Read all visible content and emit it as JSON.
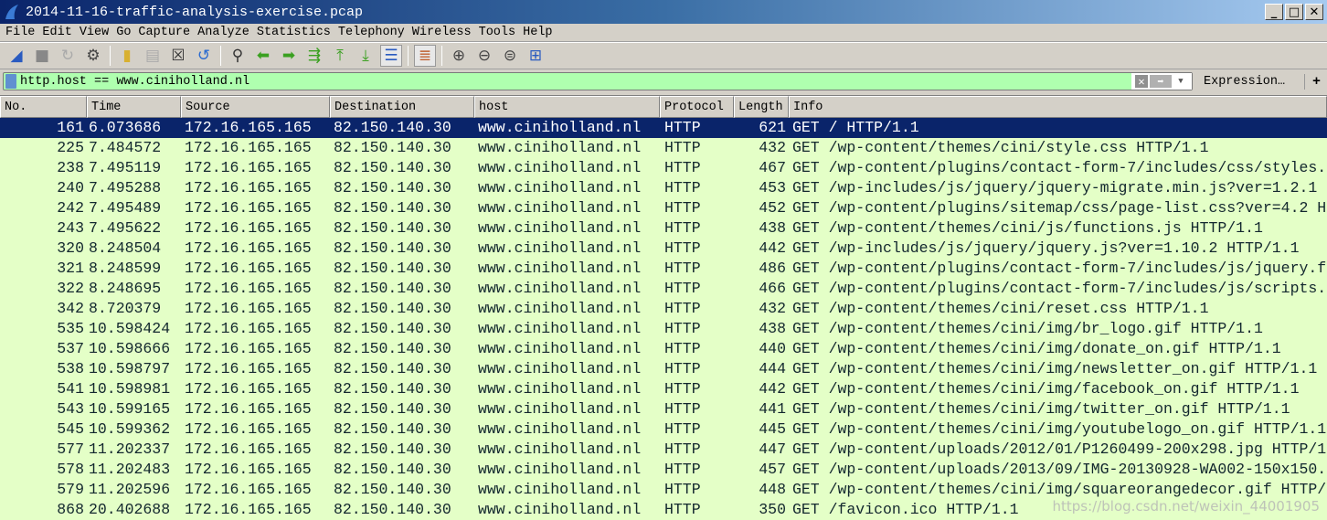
{
  "window": {
    "title": "2014-11-16-traffic-analysis-exercise.pcap",
    "controls": [
      "_",
      "□",
      "✕"
    ]
  },
  "menu": [
    "File",
    "Edit",
    "View",
    "Go",
    "Capture",
    "Analyze",
    "Statistics",
    "Telephony",
    "Wireless",
    "Tools",
    "Help"
  ],
  "toolbar": [
    "start-capture",
    "stop-capture",
    "restart-capture",
    "capture-options",
    "open-file",
    "save-file",
    "close-file",
    "reload-file",
    "find-packet",
    "go-back",
    "go-forward",
    "go-to-packet",
    "go-first",
    "go-last",
    "auto-scroll",
    "colorize",
    "zoom-in",
    "zoom-out",
    "zoom-normal",
    "resize-columns"
  ],
  "filter": {
    "value": "http.host == www.ciniholland.nl",
    "expression_label": "Expression…",
    "add_label": "+"
  },
  "columns": [
    "No.",
    "Time",
    "Source",
    "Destination",
    "host",
    "Protocol",
    "Length",
    "Info"
  ],
  "rows": [
    [
      "161",
      "6.073686",
      "172.16.165.165",
      "82.150.140.30",
      "www.ciniholland.nl",
      "HTTP",
      "621",
      "GET / HTTP/1.1"
    ],
    [
      "225",
      "7.484572",
      "172.16.165.165",
      "82.150.140.30",
      "www.ciniholland.nl",
      "HTTP",
      "432",
      "GET /wp-content/themes/cini/style.css HTTP/1.1"
    ],
    [
      "238",
      "7.495119",
      "172.16.165.165",
      "82.150.140.30",
      "www.ciniholland.nl",
      "HTTP",
      "467",
      "GET /wp-content/plugins/contact-form-7/includes/css/styles."
    ],
    [
      "240",
      "7.495288",
      "172.16.165.165",
      "82.150.140.30",
      "www.ciniholland.nl",
      "HTTP",
      "453",
      "GET /wp-includes/js/jquery/jquery-migrate.min.js?ver=1.2.1"
    ],
    [
      "242",
      "7.495489",
      "172.16.165.165",
      "82.150.140.30",
      "www.ciniholland.nl",
      "HTTP",
      "452",
      "GET /wp-content/plugins/sitemap/css/page-list.css?ver=4.2 H"
    ],
    [
      "243",
      "7.495622",
      "172.16.165.165",
      "82.150.140.30",
      "www.ciniholland.nl",
      "HTTP",
      "438",
      "GET /wp-content/themes/cini/js/functions.js HTTP/1.1"
    ],
    [
      "320",
      "8.248504",
      "172.16.165.165",
      "82.150.140.30",
      "www.ciniholland.nl",
      "HTTP",
      "442",
      "GET /wp-includes/js/jquery/jquery.js?ver=1.10.2 HTTP/1.1"
    ],
    [
      "321",
      "8.248599",
      "172.16.165.165",
      "82.150.140.30",
      "www.ciniholland.nl",
      "HTTP",
      "486",
      "GET /wp-content/plugins/contact-form-7/includes/js/jquery.f"
    ],
    [
      "322",
      "8.248695",
      "172.16.165.165",
      "82.150.140.30",
      "www.ciniholland.nl",
      "HTTP",
      "466",
      "GET /wp-content/plugins/contact-form-7/includes/js/scripts."
    ],
    [
      "342",
      "8.720379",
      "172.16.165.165",
      "82.150.140.30",
      "www.ciniholland.nl",
      "HTTP",
      "432",
      "GET /wp-content/themes/cini/reset.css HTTP/1.1"
    ],
    [
      "535",
      "10.598424",
      "172.16.165.165",
      "82.150.140.30",
      "www.ciniholland.nl",
      "HTTP",
      "438",
      "GET /wp-content/themes/cini/img/br_logo.gif HTTP/1.1"
    ],
    [
      "537",
      "10.598666",
      "172.16.165.165",
      "82.150.140.30",
      "www.ciniholland.nl",
      "HTTP",
      "440",
      "GET /wp-content/themes/cini/img/donate_on.gif HTTP/1.1"
    ],
    [
      "538",
      "10.598797",
      "172.16.165.165",
      "82.150.140.30",
      "www.ciniholland.nl",
      "HTTP",
      "444",
      "GET /wp-content/themes/cini/img/newsletter_on.gif HTTP/1.1"
    ],
    [
      "541",
      "10.598981",
      "172.16.165.165",
      "82.150.140.30",
      "www.ciniholland.nl",
      "HTTP",
      "442",
      "GET /wp-content/themes/cini/img/facebook_on.gif HTTP/1.1"
    ],
    [
      "543",
      "10.599165",
      "172.16.165.165",
      "82.150.140.30",
      "www.ciniholland.nl",
      "HTTP",
      "441",
      "GET /wp-content/themes/cini/img/twitter_on.gif HTTP/1.1"
    ],
    [
      "545",
      "10.599362",
      "172.16.165.165",
      "82.150.140.30",
      "www.ciniholland.nl",
      "HTTP",
      "445",
      "GET /wp-content/themes/cini/img/youtubelogo_on.gif HTTP/1.1"
    ],
    [
      "577",
      "11.202337",
      "172.16.165.165",
      "82.150.140.30",
      "www.ciniholland.nl",
      "HTTP",
      "447",
      "GET /wp-content/uploads/2012/01/P1260499-200x298.jpg HTTP/1"
    ],
    [
      "578",
      "11.202483",
      "172.16.165.165",
      "82.150.140.30",
      "www.ciniholland.nl",
      "HTTP",
      "457",
      "GET /wp-content/uploads/2013/09/IMG-20130928-WA002-150x150."
    ],
    [
      "579",
      "11.202596",
      "172.16.165.165",
      "82.150.140.30",
      "www.ciniholland.nl",
      "HTTP",
      "448",
      "GET /wp-content/themes/cini/img/squareorangedecor.gif HTTP/"
    ],
    [
      "868",
      "20.402688",
      "172.16.165.165",
      "82.150.140.30",
      "www.ciniholland.nl",
      "HTTP",
      "350",
      "GET /favicon.ico HTTP/1.1"
    ]
  ],
  "selected_row": 0,
  "watermark": "https://blog.csdn.net/weixin_44001905",
  "colors": {
    "row_bg": "#e4ffc7",
    "selected_bg": "#0a246a",
    "filter_valid": "#afffaf"
  }
}
